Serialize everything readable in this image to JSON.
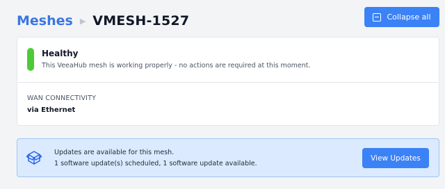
{
  "header": {
    "breadcrumb_root": "Meshes",
    "breadcrumb_current": "VMESH-1527",
    "collapse_label": "Collapse all"
  },
  "status": {
    "title": "Healthy",
    "description": "This VeeaHub mesh is working properly - no actions are required at this moment.",
    "color": "#4ccb37"
  },
  "wan": {
    "label": "WAN CONNECTIVITY",
    "value": "via Ethernet"
  },
  "updates": {
    "line1": "Updates are available for this mesh.",
    "line2": "1 software update(s) scheduled, 1 software update available.",
    "button_label": "View Updates",
    "icon": "package-icon"
  },
  "colors": {
    "accent": "#3b82f6",
    "link": "#3b76e0",
    "banner_bg": "#dbeafe"
  }
}
